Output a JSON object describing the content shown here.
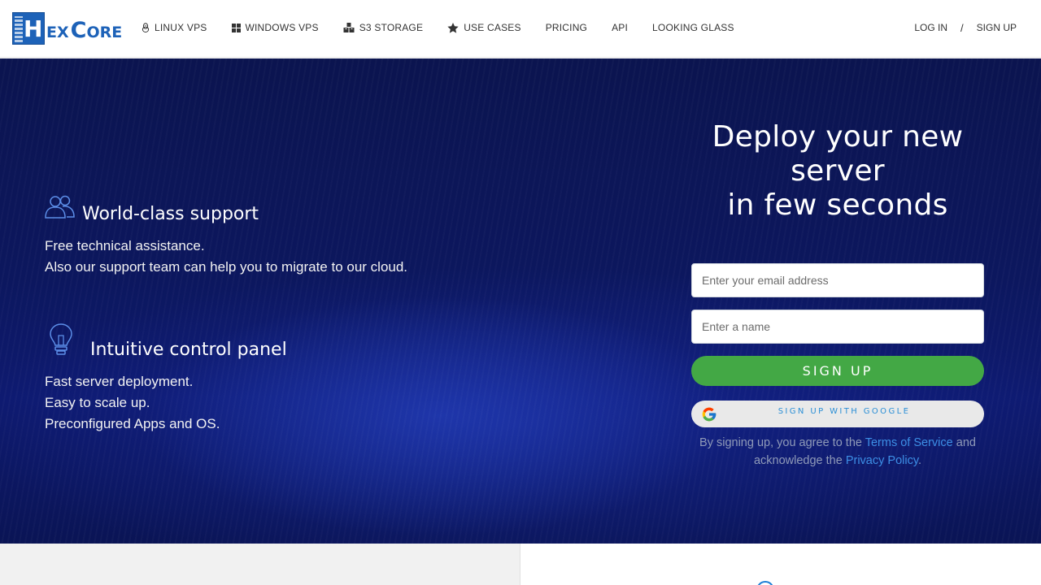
{
  "brand": {
    "logo_text": "HexCore",
    "colors": {
      "primary": "#1d62b8",
      "hero_bg": "#0c175e",
      "signup_green": "#43a845",
      "link_blue": "#3d8fe6"
    }
  },
  "nav": {
    "items": [
      {
        "label": "LINUX VPS",
        "icon": "linux-penguin-icon"
      },
      {
        "label": "WINDOWS VPS",
        "icon": "windows-icon"
      },
      {
        "label": "S3 STORAGE",
        "icon": "storage-boxes-icon"
      },
      {
        "label": "USE CASES",
        "icon": "star-icon"
      },
      {
        "label": "PRICING",
        "icon": ""
      },
      {
        "label": "API",
        "icon": ""
      },
      {
        "label": "LOOKING GLASS",
        "icon": ""
      }
    ],
    "login": "LOG IN",
    "separator": "/",
    "signup": "SIGN UP"
  },
  "features": [
    {
      "icon": "users-icon",
      "title": "World-class support",
      "lines": [
        "Free technical assistance.",
        "Also our support team can help you to migrate to our cloud."
      ]
    },
    {
      "icon": "lightbulb-icon",
      "title": "Intuitive control panel",
      "lines": [
        "Fast server deployment.",
        "Easy to scale up.",
        "Preconfigured Apps and OS."
      ]
    }
  ],
  "signup": {
    "heading_lines": [
      "Deploy your new",
      "server",
      "in few seconds"
    ],
    "email_placeholder": "Enter your email address",
    "name_placeholder": "Enter a name",
    "signup_button": "SIGN UP",
    "google_button": "SIGN UP WITH GOOGLE",
    "terms_prefix": "By signing up, you agree to the",
    "terms_link": "Terms of Service",
    "terms_middle": "and acknowledge the",
    "privacy_link": "Privacy Policy",
    "terms_suffix": "."
  }
}
